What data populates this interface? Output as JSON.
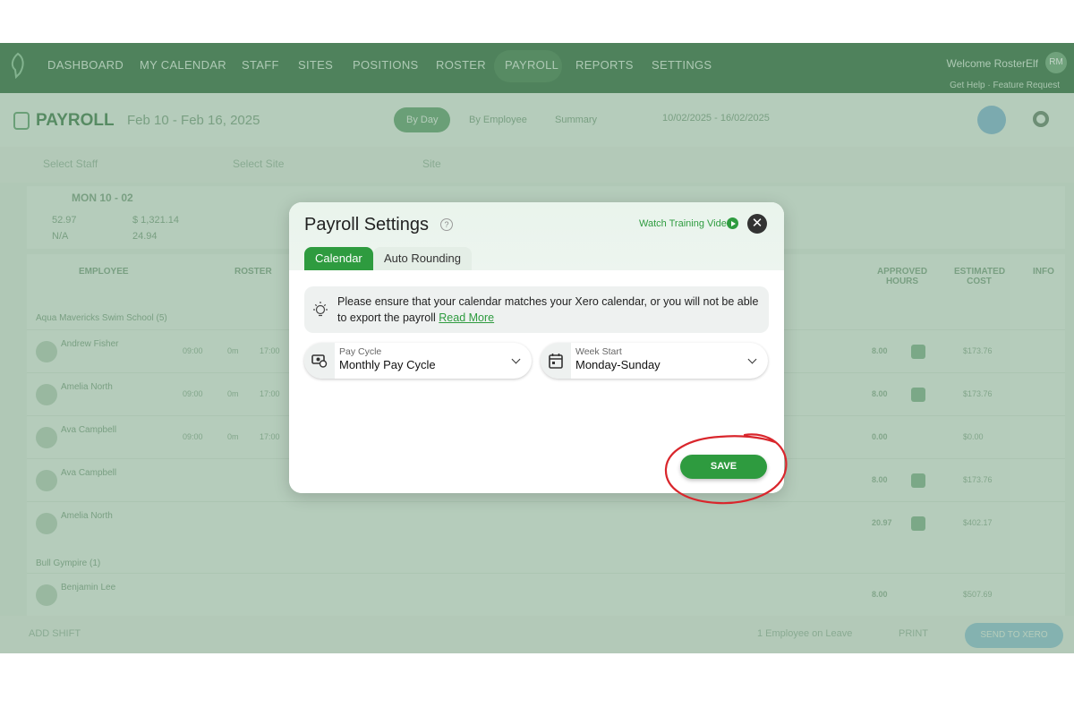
{
  "app": {
    "nav": [
      "DASHBOARD",
      "MY CALENDAR",
      "STAFF",
      "SITES",
      "POSITIONS",
      "ROSTER",
      "PAYROLL",
      "REPORTS",
      "SETTINGS"
    ],
    "welcome": "Welcome RosterElf",
    "user_initials": "RM",
    "help_links": "Get Help  ·  Feature Request",
    "page_title": "PAYROLL",
    "date_title": "Feb 10 - Feb 16, 2025",
    "view_tabs": [
      "By Day",
      "By Employee",
      "Summary"
    ],
    "date_range": "10/02/2025 - 16/02/2025",
    "filters": {
      "staff_placeholder": "Select Staff",
      "site_placeholder": "Select Site",
      "group_by": "Site"
    },
    "summary": {
      "day": "MON 10 - 02",
      "hours": "52.97",
      "cost": "$ 1,321.14",
      "na": "N/A",
      "ratio": "24.94"
    },
    "table": {
      "headers": [
        "EMPLOYEE",
        "ROSTER",
        "APPROVED HOURS",
        "ESTIMATED COST",
        "INFO"
      ],
      "group1": "Aqua Mavericks Swim School (5)",
      "group2": "Bull Gympire (1)",
      "rows": [
        {
          "name": "Andrew Fisher",
          "start": "09:00",
          "brk": "0m",
          "finish": "17:00",
          "hours": "8.00",
          "cost": "$173.76"
        },
        {
          "name": "Amelia North",
          "start": "09:00",
          "brk": "0m",
          "finish": "17:00",
          "hours": "8.00",
          "cost": "$173.76"
        },
        {
          "name": "Ava Campbell",
          "start": "09:00",
          "brk": "0m",
          "finish": "17:00",
          "hours": "0.00",
          "cost": "$0.00"
        },
        {
          "name": "Ava Campbell",
          "start": "",
          "brk": "",
          "finish": "",
          "hours": "8.00",
          "cost": "$173.76"
        },
        {
          "name": "Amelia North",
          "start": "",
          "brk": "",
          "finish": "",
          "hours": "20.97",
          "cost": "$402.17"
        },
        {
          "name": "Benjamin Lee",
          "start": "",
          "brk": "",
          "finish": "",
          "hours": "8.00",
          "cost": "$507.69"
        }
      ]
    },
    "bottom": {
      "add_shift": "ADD SHIFT",
      "on_leave": "1 Employee on Leave",
      "print": "PRINT",
      "send": "SEND TO XERO"
    }
  },
  "modal": {
    "title": "Payroll Settings",
    "help_glyph": "?",
    "watch_video": "Watch Training Video",
    "close_glyph": "✕",
    "tabs": {
      "calendar": "Calendar",
      "auto_rounding": "Auto Rounding"
    },
    "notice_text": "Please ensure that your calendar matches your Xero calendar, or you will not be able to export the payroll",
    "notice_link": "Read More",
    "pay_cycle": {
      "label": "Pay Cycle",
      "value": "Monthly Pay Cycle"
    },
    "week_start": {
      "label": "Week Start",
      "value": "Monday-Sunday"
    },
    "save": "SAVE"
  },
  "colors": {
    "accent": "#2e9b3f",
    "annotation": "#d9262c"
  },
  "icons": [
    "logo-icon",
    "question-icon",
    "play-icon",
    "close-icon",
    "lightbulb-icon",
    "cash-cycle-icon",
    "calendar-icon",
    "chevron-down-icon"
  ]
}
